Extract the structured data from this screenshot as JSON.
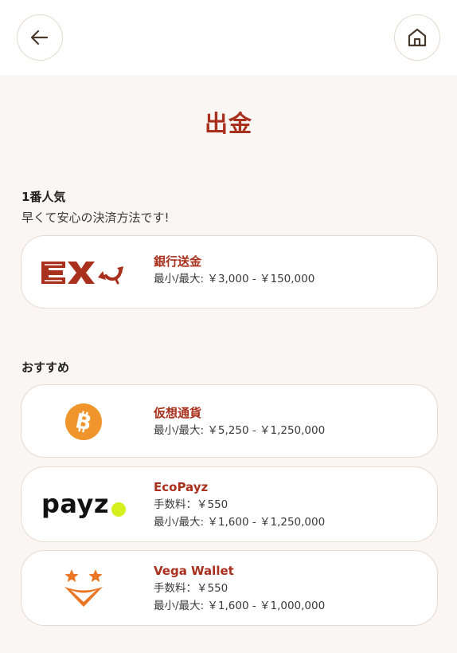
{
  "header": {
    "back_icon": "arrow-left-icon",
    "home_icon": "home-icon"
  },
  "page": {
    "title": "出金"
  },
  "popular": {
    "title": "1番人気",
    "subtitle": "早くて安心の決済方法です!"
  },
  "recommended": {
    "title": "おすすめ"
  },
  "methods": [
    {
      "logo": "ex-logo",
      "name": "銀行送金",
      "limits": "最小/最大: ￥3,000 - ￥150,000"
    },
    {
      "logo": "bitcoin-logo",
      "name": "仮想通貨",
      "limits": "最小/最大: ￥5,250 - ￥1,250,000"
    },
    {
      "logo": "payz-logo",
      "logo_text": "payz",
      "name": "EcoPayz",
      "fee": "手数料：￥550",
      "limits": "最小/最大: ￥1,600 - ￥1,250,000"
    },
    {
      "logo": "vega-wallet-logo",
      "name": "Vega Wallet",
      "fee": "手数料：￥550",
      "limits": "最小/最大: ￥1,600 - ￥1,000,000"
    }
  ],
  "colors": {
    "accent": "#a9301d",
    "background": "#f9f6f3",
    "card_border": "#e6dccf",
    "bitcoin": "#f0952c",
    "payz_dot": "#d4f01e",
    "vega": "#ea7624"
  }
}
